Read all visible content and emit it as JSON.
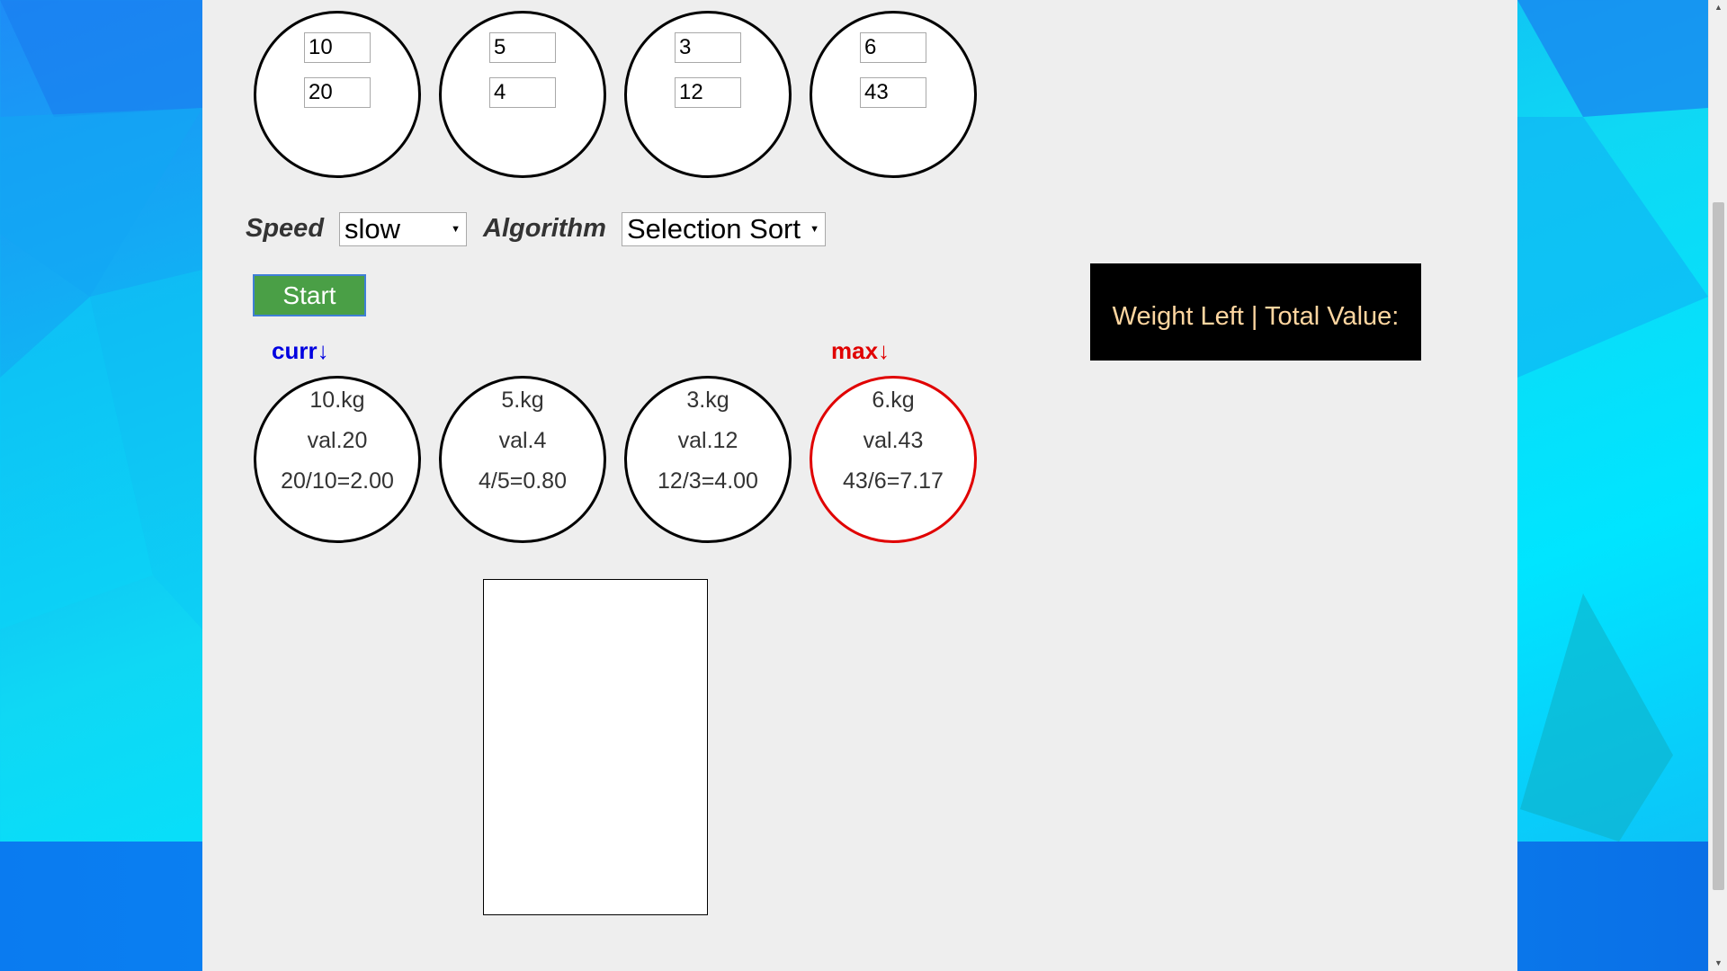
{
  "inputs": [
    {
      "weight": "10",
      "value": "20"
    },
    {
      "weight": "5",
      "value": "4"
    },
    {
      "weight": "3",
      "value": "12"
    },
    {
      "weight": "6",
      "value": "43"
    }
  ],
  "controls": {
    "speed_label": "Speed",
    "speed_value": "slow",
    "algorithm_label": "Algorithm",
    "algorithm_value": "Selection Sort",
    "start_label": "Start"
  },
  "result": {
    "label": "Weight Left | Total Value:"
  },
  "pointers": {
    "curr": "curr↓",
    "max": "max↓"
  },
  "items": [
    {
      "weight": "10.kg",
      "value": "val.20",
      "ratio": "20/10=2.00"
    },
    {
      "weight": "5.kg",
      "value": "val.4",
      "ratio": "4/5=0.80"
    },
    {
      "weight": "3.kg",
      "value": "val.12",
      "ratio": "12/3=4.00"
    },
    {
      "weight": "6.kg",
      "value": "val.43",
      "ratio": "43/6=7.17"
    }
  ],
  "colors": {
    "curr": "#0000e0",
    "max": "#e00000",
    "start_button": "#4a9f46",
    "result_text": "#ffd6a0"
  },
  "icons": {
    "select_arrow": "triangle-down-icon",
    "scroll_up": "scroll-up-arrow-icon",
    "scroll_down": "scroll-down-arrow-icon"
  }
}
